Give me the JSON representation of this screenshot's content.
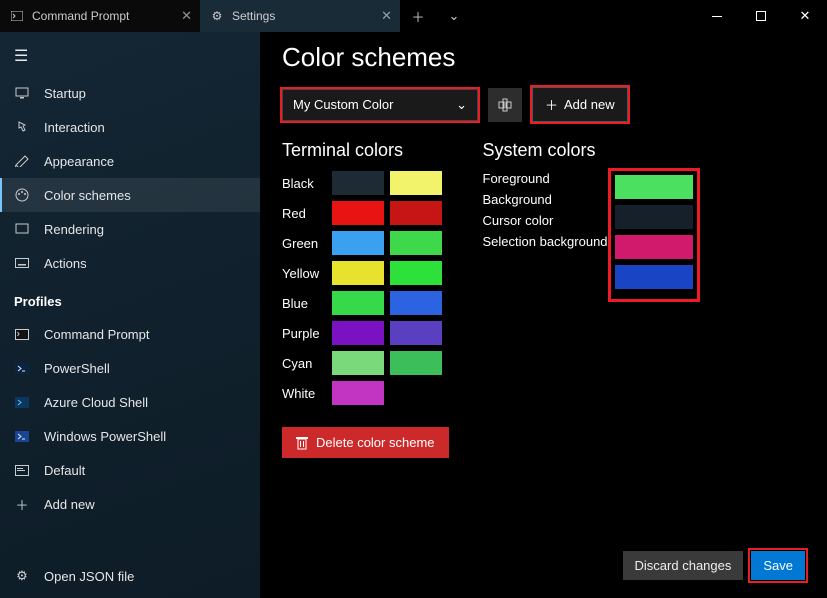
{
  "tabs": [
    {
      "label": "Command Prompt",
      "active": false
    },
    {
      "label": "Settings",
      "active": true
    }
  ],
  "sidebar": {
    "items": [
      {
        "icon": "startup",
        "label": "Startup"
      },
      {
        "icon": "interaction",
        "label": "Interaction"
      },
      {
        "icon": "appearance",
        "label": "Appearance"
      },
      {
        "icon": "color-schemes",
        "label": "Color schemes",
        "selected": true
      },
      {
        "icon": "rendering",
        "label": "Rendering"
      },
      {
        "icon": "actions",
        "label": "Actions"
      }
    ],
    "profilesHeader": "Profiles",
    "profiles": [
      {
        "label": "Command Prompt"
      },
      {
        "label": "PowerShell"
      },
      {
        "label": "Azure Cloud Shell"
      },
      {
        "label": "Windows PowerShell"
      },
      {
        "label": "Default"
      }
    ],
    "addNew": "Add new",
    "openJson": "Open JSON file"
  },
  "page": {
    "title": "Color schemes",
    "schemeSelected": "My Custom Color",
    "addNew": "Add new",
    "deleteScheme": "Delete color scheme",
    "discard": "Discard changes",
    "save": "Save"
  },
  "terminal": {
    "title": "Terminal colors",
    "rows": [
      {
        "name": "Black",
        "a": "#1e2b35",
        "b": "#f2f26b"
      },
      {
        "name": "Red",
        "a": "#e81313",
        "b": "#c51515"
      },
      {
        "name": "Green",
        "a": "#3aa0f0",
        "b": "#3fd84b"
      },
      {
        "name": "Yellow",
        "a": "#e6e22e",
        "b": "#2de03a"
      },
      {
        "name": "Blue",
        "a": "#35d94a",
        "b": "#2b63e0"
      },
      {
        "name": "Purple",
        "a": "#7a12c4",
        "b": "#5a3fc0"
      },
      {
        "name": "Cyan",
        "a": "#7ad97a",
        "b": "#3cbf5a"
      },
      {
        "name": "White",
        "a": "#c234c2",
        "b": "#000000"
      }
    ]
  },
  "system": {
    "title": "System colors",
    "rows": [
      {
        "name": "Foreground",
        "c": "#4be060"
      },
      {
        "name": "Background",
        "c": "#15202b"
      },
      {
        "name": "Cursor color",
        "c": "#d11a6b"
      },
      {
        "name": "Selection background",
        "c": "#1944c4"
      }
    ]
  }
}
